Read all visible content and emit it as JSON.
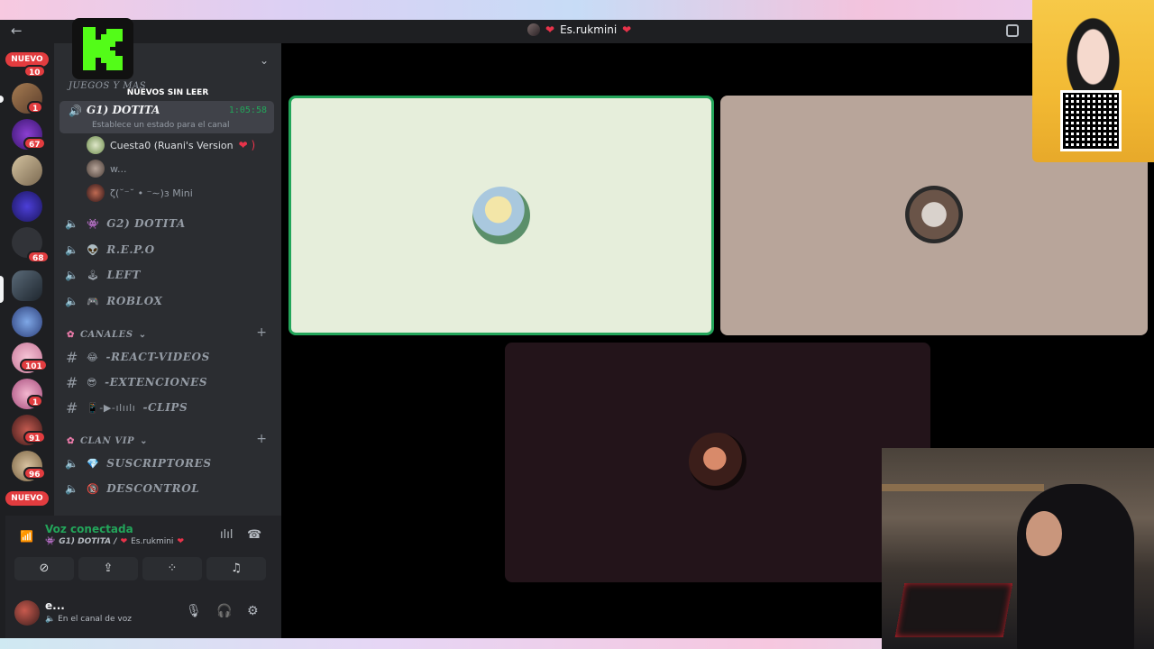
{
  "titlebar": {
    "title": "Es.rukmini"
  },
  "rail": {
    "badges": [
      "10",
      "1",
      "67",
      "68",
      "101",
      "1",
      "91",
      "96"
    ],
    "new_label_top": "NUEVO",
    "new_label_bottom": "NUEVO"
  },
  "sidebar": {
    "unread_tip": "NUEVOS SIN LEER",
    "category_peek": "JUEGOS Y MAS",
    "active_voice": {
      "name": "G1) DOTITA",
      "timer": "1:05:58",
      "status": "Establece un estado para el canal"
    },
    "members": [
      {
        "name": "Cuesta0 (Ruani's Version"
      },
      {
        "name": "w..."
      },
      {
        "name": "ζ(˘⁻˘ • ⁻∼)ɜ Mini"
      }
    ],
    "voice_channels_top": [
      {
        "name": "G2) DOTITA",
        "emoji": "👾"
      },
      {
        "name": "R.E.P.O",
        "emoji": "👽"
      },
      {
        "name": "LEFT",
        "emoji": "🕹"
      },
      {
        "name": "ROBLOX",
        "emoji": "🎮"
      }
    ],
    "category_canales": "CANALES",
    "text_channels": [
      {
        "name": "-REACT-VIDEOS",
        "emoji": "😂"
      },
      {
        "name": "-EXTENCIONES",
        "emoji": "😎"
      },
      {
        "name": "-CLIPS",
        "emoji": "📱-▶︎-ılıılı"
      }
    ],
    "category_vip": "CLAN VIP",
    "vip_channels": [
      {
        "name": "SUSCRIPTORES",
        "emoji": "💎"
      },
      {
        "name": "DESCONTROL",
        "emoji": "🔞"
      }
    ]
  },
  "voice_panel": {
    "title": "Voz conectada",
    "channel": "G1) DOTITA /",
    "user": "Es.rukmini"
  },
  "user_panel": {
    "name": "e...",
    "status": "En el canal de voz"
  },
  "icons": {
    "back": "arrow-left-icon",
    "speaker": "speaker-icon",
    "hash": "hash-icon",
    "mic": "microphone-icon",
    "headset": "headset-icon",
    "settings": "gear-icon"
  },
  "colors": {
    "accent_green": "#23a55a",
    "badge_red": "#e23c3f",
    "tile_1": "#e6eedb",
    "tile_2": "#b8a59a",
    "tile_3": "#23141a"
  }
}
